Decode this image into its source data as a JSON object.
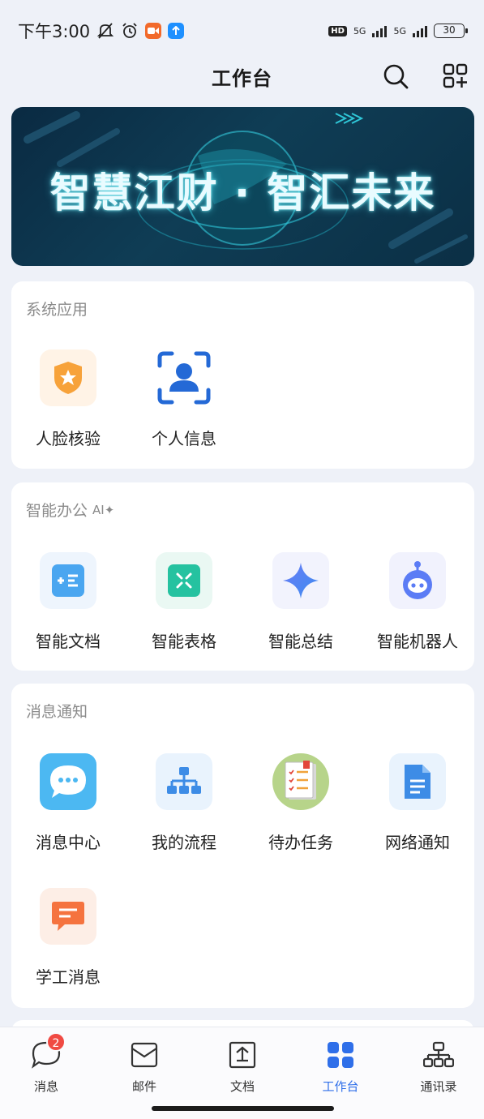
{
  "status_bar": {
    "time": "下午3:00",
    "network_left": "5G",
    "network_right": "5G",
    "hd": "HD",
    "battery": "30"
  },
  "header": {
    "title": "工作台"
  },
  "banner": {
    "text": "智慧江财 · 智汇未来"
  },
  "sections": [
    {
      "title": "系统应用",
      "apps": [
        {
          "label": "人脸核验",
          "icon": "shield-star-icon"
        },
        {
          "label": "个人信息",
          "icon": "face-scan-icon"
        }
      ]
    },
    {
      "title": "智能办公",
      "tag": "AI✦",
      "apps": [
        {
          "label": "智能文档",
          "icon": "smart-doc-icon"
        },
        {
          "label": "智能表格",
          "icon": "smart-table-icon"
        },
        {
          "label": "智能总结",
          "icon": "sparkle-icon"
        },
        {
          "label": "智能机器人",
          "icon": "robot-icon"
        }
      ]
    },
    {
      "title": "消息通知",
      "apps": [
        {
          "label": "消息中心",
          "icon": "chat-bubble-icon"
        },
        {
          "label": "我的流程",
          "icon": "org-chart-icon"
        },
        {
          "label": "待办任务",
          "icon": "task-list-icon"
        },
        {
          "label": "网络通知",
          "icon": "document-icon"
        },
        {
          "label": "学工消息",
          "icon": "message-icon"
        }
      ]
    }
  ],
  "tabbar": {
    "tabs": [
      {
        "label": "消息",
        "badge": "2"
      },
      {
        "label": "邮件"
      },
      {
        "label": "文档"
      },
      {
        "label": "工作台",
        "active": true
      },
      {
        "label": "通讯录"
      }
    ]
  },
  "colors": {
    "accent": "#2f6fe9",
    "badge": "#f04a43"
  }
}
